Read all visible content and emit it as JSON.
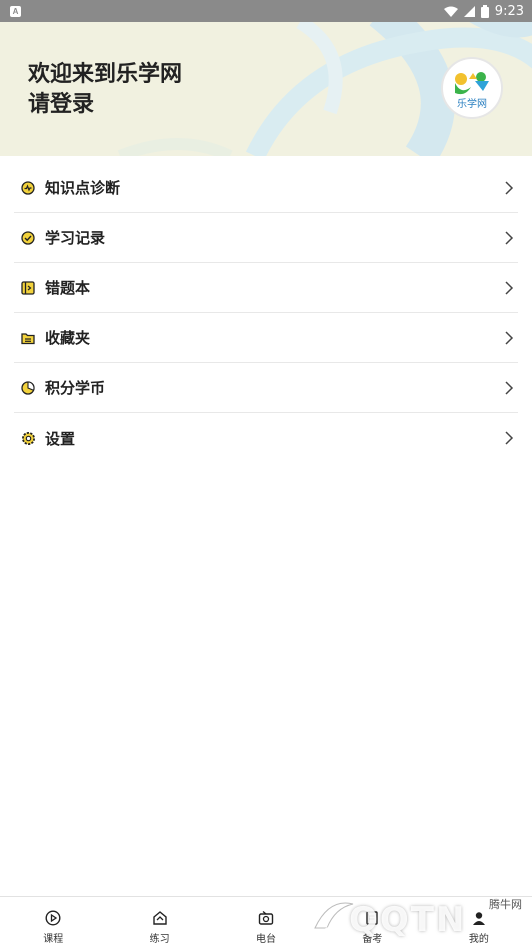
{
  "status_bar": {
    "time": "9:23",
    "left_badge": "A"
  },
  "header": {
    "welcome_line1": "欢迎来到乐学网",
    "welcome_line2": "请登录",
    "avatar_logo_text": "乐学网"
  },
  "menu": [
    {
      "label": "知识点诊断",
      "icon": "diagnosis-icon"
    },
    {
      "label": "学习记录",
      "icon": "check-circle-icon"
    },
    {
      "label": "错题本",
      "icon": "notebook-icon"
    },
    {
      "label": "收藏夹",
      "icon": "folder-icon"
    },
    {
      "label": "积分学币",
      "icon": "coin-icon"
    },
    {
      "label": "设置",
      "icon": "gear-icon"
    }
  ],
  "tabbar": [
    {
      "label": "课程",
      "icon": "play-circle-icon"
    },
    {
      "label": "练习",
      "icon": "practice-icon"
    },
    {
      "label": "电台",
      "icon": "radio-icon"
    },
    {
      "label": "备考",
      "icon": "exam-icon"
    },
    {
      "label": "我的",
      "icon": "profile-icon"
    }
  ],
  "watermark": {
    "text": "QQTN",
    "site": "腾牛网"
  },
  "colors": {
    "accent": "#f2d23c",
    "header_bg": "#f1f1e0",
    "header_swirl": "#d4e8ef",
    "text": "#222222"
  }
}
